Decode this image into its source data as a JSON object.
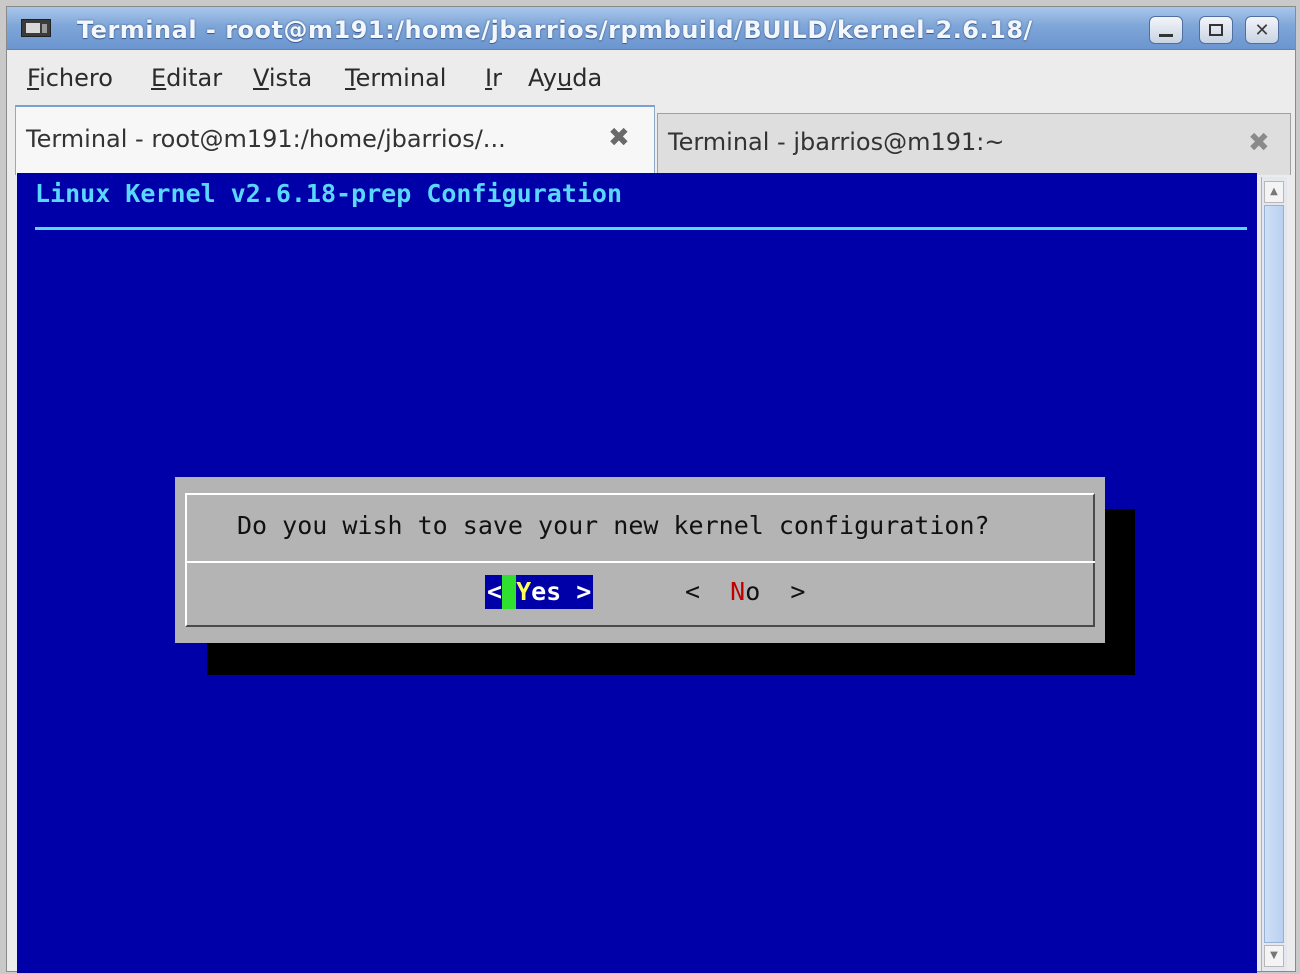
{
  "window": {
    "title": "Terminal - root@m191:/home/jbarrios/rpmbuild/BUILD/kernel-2.6.18/",
    "buttons": {
      "minimize": "",
      "maximize": "",
      "close": "✕"
    }
  },
  "menubar": {
    "items": [
      {
        "mnemonic": "F",
        "rest": "ichero"
      },
      {
        "mnemonic": "E",
        "rest": "ditar"
      },
      {
        "mnemonic": "V",
        "rest": "ista"
      },
      {
        "mnemonic": "T",
        "rest": "erminal"
      },
      {
        "mnemonic": "I",
        "rest": "r"
      },
      {
        "prefix": "Ay",
        "mnemonic": "u",
        "rest": "da"
      }
    ]
  },
  "tabs": [
    {
      "label": "Terminal - root@m191:/home/jbarrios/...",
      "close": "✖",
      "active": true
    },
    {
      "label": "Terminal - jbarrios@m191:~",
      "close": "✖",
      "active": false
    }
  ],
  "terminal": {
    "header": "Linux Kernel v2.6.18-prep Configuration",
    "dialog": {
      "question": "Do you wish to save your new kernel configuration?",
      "yes": {
        "open": "<",
        "hot": "Y",
        "rest": "es",
        "close": " >"
      },
      "no": {
        "open": "<  ",
        "hot": "N",
        "rest": "o",
        "close": "  >"
      }
    }
  },
  "scrollbar": {
    "up": "▲",
    "down": "▼"
  },
  "colors": {
    "terminal_bg": "#0000a8",
    "header_text": "#5ad7ff",
    "dialog_bg": "#b4b4b4",
    "cursor": "#2fe02f"
  }
}
